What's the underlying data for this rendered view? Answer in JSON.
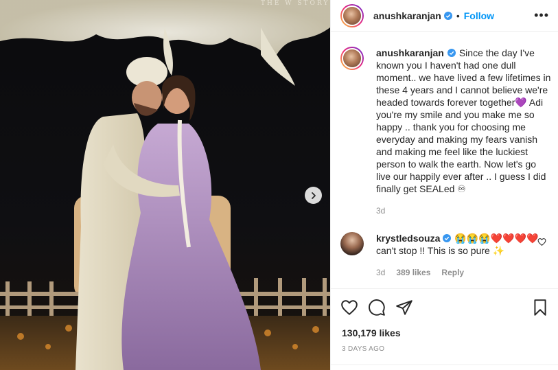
{
  "photo": {
    "watermark": "THE W STORY",
    "next_icon": "chevron-right-icon"
  },
  "post": {
    "author": "anushkaranjan",
    "follow_label": "Follow",
    "more_label": "•••",
    "caption": "Since the day I've known you I haven't had one dull moment.. we have lived a few lifetimes in these 4 years and I cannot believe we're headed towards forever together💜 Adi you're my smile and you make me so happy .. thank you for choosing me everyday and making my fears vanish and making me feel like the luckiest person to walk the earth. Now let's go live our happily ever after .. I guess I did finally get SEALed ♾",
    "caption_time": "3d"
  },
  "comment": {
    "author": "krystledsouza",
    "text": "😭😭😭❤️❤️❤️❤️ can't stop !! This is so pure ✨",
    "time": "3d",
    "likes": "389 likes",
    "reply_label": "Reply"
  },
  "footer": {
    "likes": "130,179 likes",
    "time_ago": "3 DAYS AGO"
  },
  "colors": {
    "link_blue": "#0095f6",
    "verified_blue": "#3897f0",
    "muted": "#8e8e8e",
    "border": "#efefef"
  }
}
